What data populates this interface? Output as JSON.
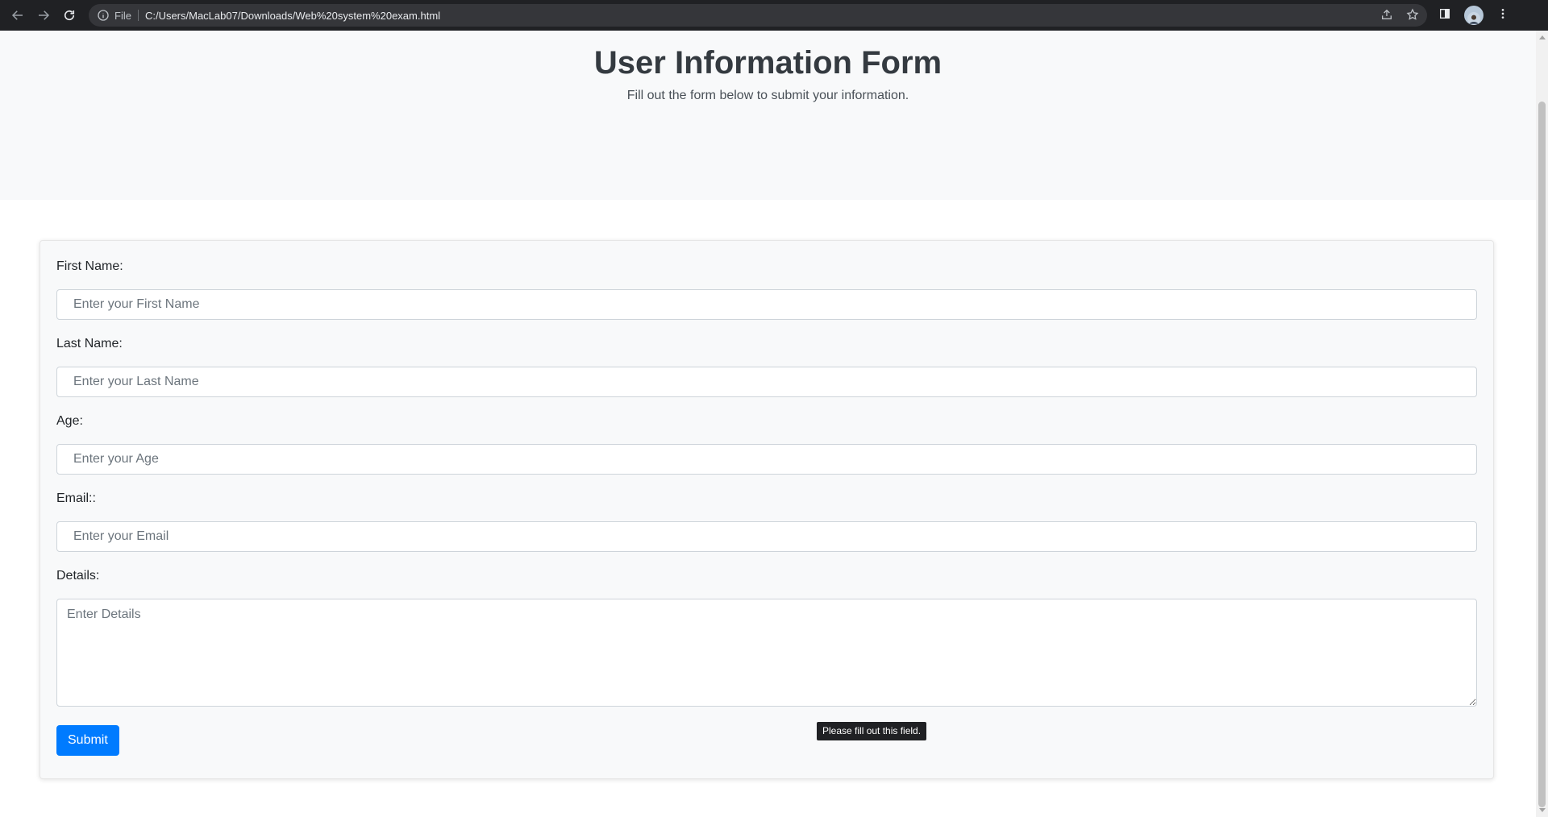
{
  "browser": {
    "scheme_label": "File",
    "url": "C:/Users/MacLab07/Downloads/Web%20system%20exam.html"
  },
  "page": {
    "title": "User Information Form",
    "subtitle": "Fill out the form below to submit your information."
  },
  "form": {
    "fields": [
      {
        "label": "First Name:",
        "placeholder": "Enter your First Name"
      },
      {
        "label": "Last Name:",
        "placeholder": "Enter your Last Name"
      },
      {
        "label": "Age:",
        "placeholder": "Enter your Age"
      },
      {
        "label": "Email::",
        "placeholder": "Enter your Email"
      }
    ],
    "details": {
      "label": "Details:",
      "placeholder": "Enter Details"
    },
    "submit_label": "Submit",
    "validation_tooltip": "Please fill out this field."
  },
  "colors": {
    "primary": "#007bff",
    "jumbotron_bg": "#f8f9fa",
    "chrome_bg": "#202124"
  }
}
